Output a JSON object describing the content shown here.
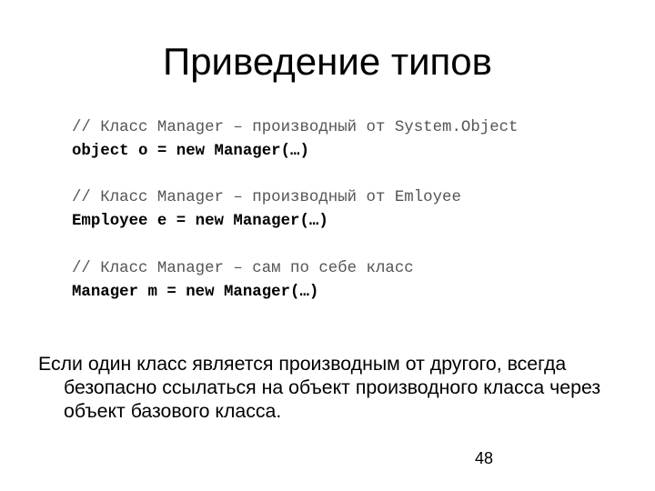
{
  "slide": {
    "title": "Приведение типов",
    "code_lines": [
      {
        "type": "comment",
        "text": "// Класс Manager – производный от System.Object"
      },
      {
        "type": "statement",
        "text": "object o = new Manager(…)"
      },
      {
        "type": "blank",
        "text": ""
      },
      {
        "type": "comment",
        "text": "// Класс Manager – производный от Emloyee"
      },
      {
        "type": "statement",
        "text": "Employee e = new Manager(…)"
      },
      {
        "type": "blank",
        "text": ""
      },
      {
        "type": "comment",
        "text": "// Класс Manager – сам по себе класс"
      },
      {
        "type": "statement",
        "text": "Manager m = new Manager(…)"
      }
    ],
    "body_text": "Если один класс является производным от другого, всегда безопасно ссылаться на объект производного класса через объект базового класса.",
    "page_number": "48"
  }
}
